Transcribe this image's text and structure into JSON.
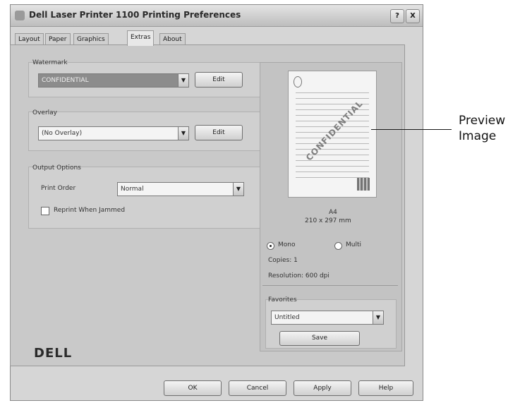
{
  "window": {
    "title": "Dell Laser Printer 1100 Printing Preferences",
    "help_button": "?",
    "close_button": "X"
  },
  "tabs": [
    {
      "label": "Layout"
    },
    {
      "label": "Paper"
    },
    {
      "label": "Graphics"
    },
    {
      "label": "Extras"
    },
    {
      "label": "About"
    }
  ],
  "watermark": {
    "group_label": "Watermark",
    "selected": "CONFIDENTIAL",
    "edit_label": "Edit"
  },
  "overlay": {
    "group_label": "Overlay",
    "selected": "(No Overlay)",
    "edit_label": "Edit"
  },
  "output_options": {
    "group_label": "Output Options",
    "print_order_label": "Print Order",
    "print_order_value": "Normal",
    "reprint_label": "Reprint When Jammed"
  },
  "preview": {
    "watermark_text": "CONFIDENTIAL",
    "paper_name": "A4",
    "paper_size": "210 x 297 mm",
    "orientation_options": [
      "Mono",
      "Multi"
    ],
    "copies": "Copies: 1",
    "resolution": "Resolution: 600 dpi",
    "favorites_label": "Favorites",
    "favorites_value": "Untitled",
    "save_label": "Save"
  },
  "callout": {
    "line1": "Preview",
    "line2": "Image"
  },
  "brand": "DELL",
  "buttons": {
    "ok": "OK",
    "cancel": "Cancel",
    "apply": "Apply",
    "help": "Help"
  }
}
